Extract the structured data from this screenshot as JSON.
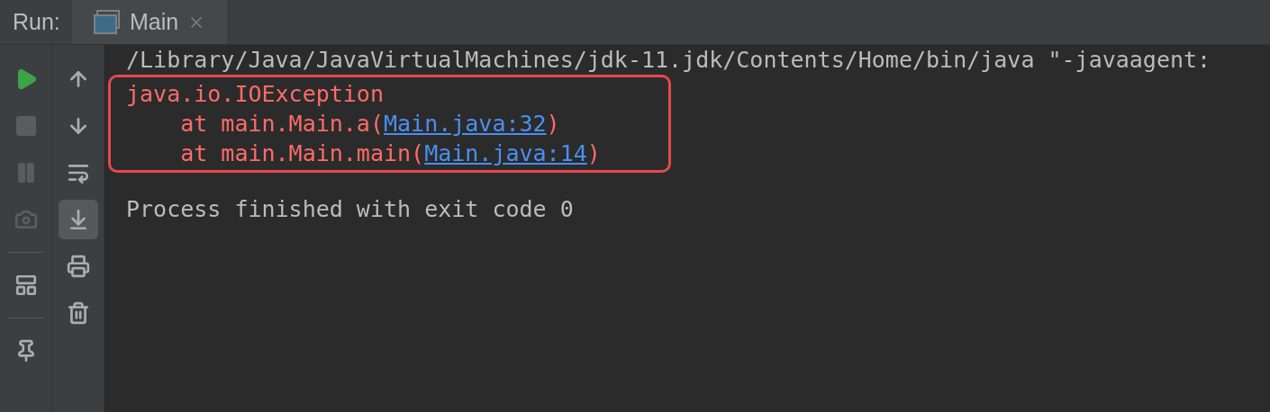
{
  "run_label": "Run:",
  "tabs": [
    {
      "label": "Main"
    }
  ],
  "toolbar_left": [
    {
      "kind": "run",
      "disabled": false
    },
    {
      "kind": "stop",
      "disabled": true
    },
    {
      "kind": "pause",
      "disabled": true
    },
    {
      "kind": "camera",
      "disabled": true
    },
    {
      "kind": "separator"
    },
    {
      "kind": "layout",
      "disabled": false
    },
    {
      "kind": "separator"
    },
    {
      "kind": "pin",
      "disabled": false
    }
  ],
  "toolbar_right": [
    {
      "kind": "up",
      "selected": false
    },
    {
      "kind": "down",
      "selected": false
    },
    {
      "kind": "wrap",
      "selected": false
    },
    {
      "kind": "scroll-end",
      "selected": true
    },
    {
      "kind": "print",
      "selected": false
    },
    {
      "kind": "trash",
      "selected": false
    }
  ],
  "console": {
    "command": "/Library/Java/JavaVirtualMachines/jdk-11.jdk/Contents/Home/bin/java \"-javaagent:",
    "highlighted_block": [
      {
        "kind": "error",
        "text": "java.io.IOException"
      },
      {
        "kind": "frame",
        "prefix": "    at main.Main.a(",
        "link": "Main.java:32",
        "suffix": ")"
      },
      {
        "kind": "frame",
        "prefix": "    at main.Main.main(",
        "link": "Main.java:14",
        "suffix": ")"
      }
    ],
    "exit": "Process finished with exit code 0"
  }
}
